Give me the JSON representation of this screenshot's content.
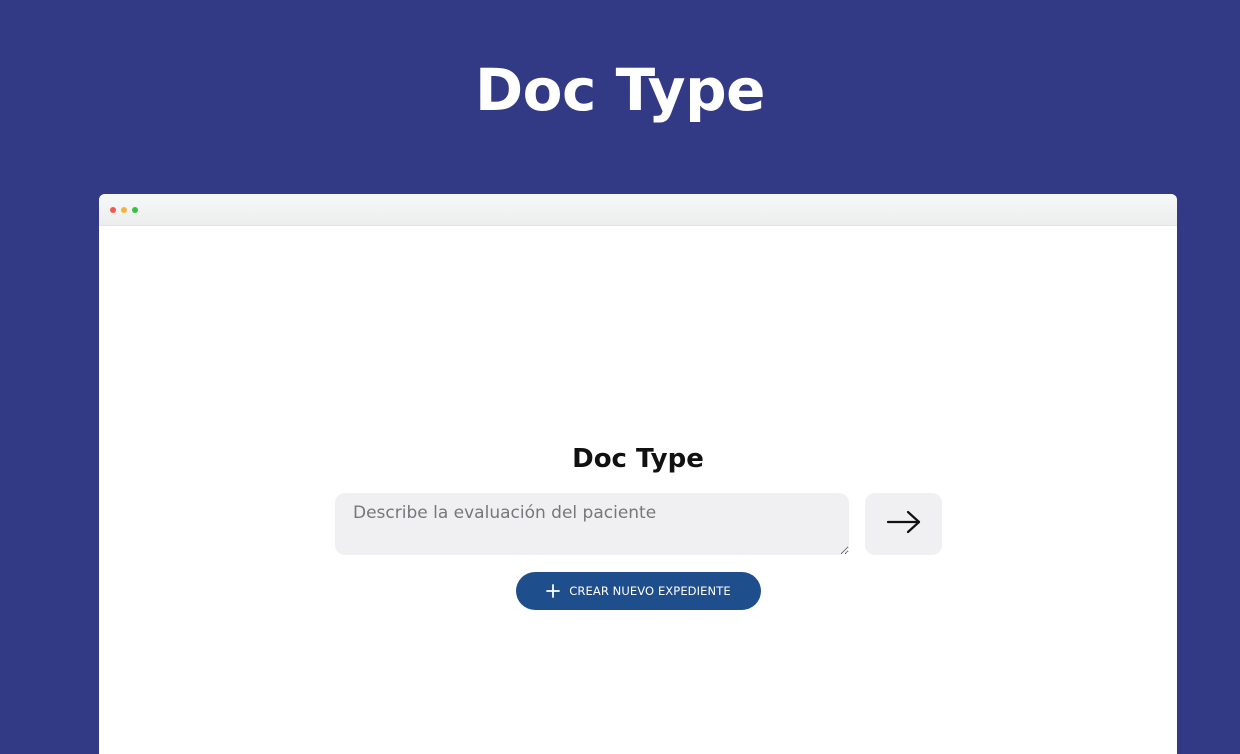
{
  "hero": {
    "title": "Doc Type"
  },
  "app": {
    "title": "Doc Type",
    "prompt": {
      "placeholder": "Describe la evaluación del paciente",
      "value": ""
    },
    "submit_icon": "arrow-right-icon",
    "create_button": {
      "icon": "plus-icon",
      "label": "CREAR NUEVO EXPEDIENTE"
    }
  },
  "colors": {
    "background": "#333a85",
    "primary_button": "#1f4e8c",
    "input_background": "#f0f0f2"
  }
}
